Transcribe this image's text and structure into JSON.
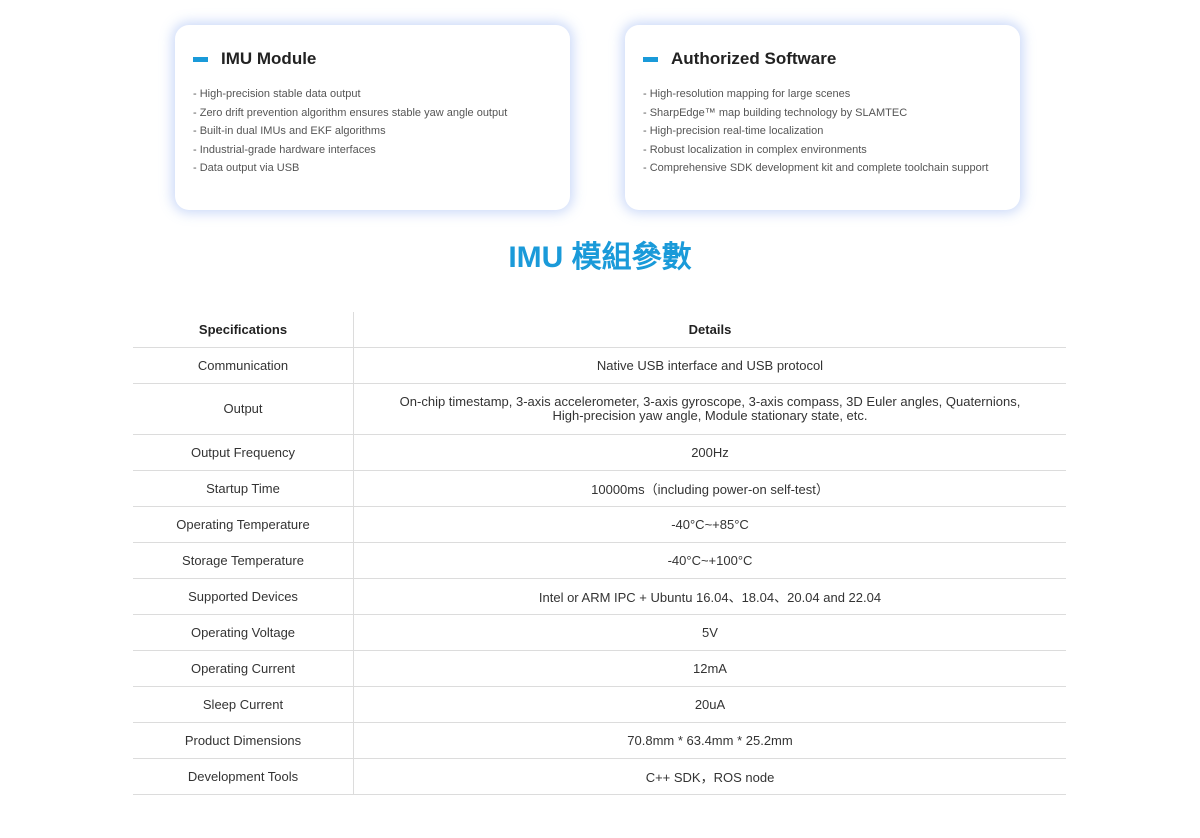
{
  "cards": [
    {
      "title": "IMU Module",
      "items": [
        "- High-precision stable data output",
        "- Zero drift prevention algorithm ensures stable yaw angle output",
        "- Built-in dual IMUs and EKF algorithms",
        "- Industrial-grade hardware interfaces",
        "- Data output via USB"
      ]
    },
    {
      "title": "Authorized Software",
      "items": [
        "- High-resolution mapping for large scenes",
        "- SharpEdge™ map building technology by SLAMTEC",
        "- High-precision real-time localization",
        "- Robust localization in complex environments",
        "- Comprehensive SDK development kit and complete toolchain support"
      ]
    }
  ],
  "section_title": "IMU 模組參數",
  "table": {
    "headers": [
      "Specifications",
      "Details"
    ],
    "rows": [
      [
        "Communication",
        "Native USB interface and USB protocol"
      ],
      [
        "Output",
        "On-chip timestamp,  3-axis accelerometer, 3-axis gyroscope, 3-axis compass, 3D Euler angles, Quaternions, High-precision yaw angle, Module stationary state, etc."
      ],
      [
        "Output Frequency",
        "200Hz"
      ],
      [
        "Startup Time",
        "10000ms（including power-on self-test）"
      ],
      [
        "Operating Temperature",
        "-40°C~+85°C"
      ],
      [
        "Storage Temperature",
        "-40°C~+100°C"
      ],
      [
        "Supported Devices",
        "Intel or ARM IPC + Ubuntu 16.04、18.04、20.04 and 22.04"
      ],
      [
        "Operating Voltage",
        "5V"
      ],
      [
        "Operating Current",
        "12mA"
      ],
      [
        "Sleep Current",
        "20uA"
      ],
      [
        "Product Dimensions",
        "70.8mm * 63.4mm *  25.2mm"
      ],
      [
        "Development Tools",
        "C++ SDK，ROS node"
      ]
    ]
  }
}
